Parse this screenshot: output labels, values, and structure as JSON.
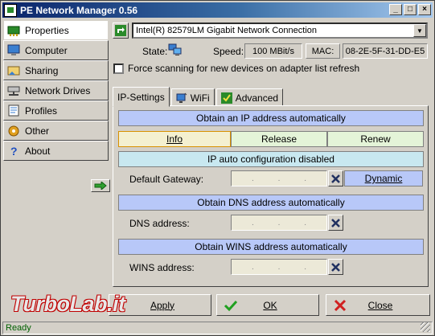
{
  "window": {
    "title": "PE Network Manager 0.56",
    "controls": {
      "minimize": "_",
      "maximize": "□",
      "close": "×"
    }
  },
  "sidebar": {
    "items": [
      {
        "label": "Properties",
        "icon": "network-card-icon",
        "active": true
      },
      {
        "label": "Computer",
        "icon": "computer-icon",
        "active": false
      },
      {
        "label": "Sharing",
        "icon": "sharing-icon",
        "active": false
      },
      {
        "label": "Network Drives",
        "icon": "network-drive-icon",
        "active": false
      },
      {
        "label": "Profiles",
        "icon": "profiles-icon",
        "active": false
      },
      {
        "label": "Other",
        "icon": "other-icon",
        "active": false
      },
      {
        "label": "About",
        "icon": "help-icon",
        "active": false
      }
    ]
  },
  "adapter": {
    "selected": "Intel(R) 82579LM Gigabit Network Connection"
  },
  "status": {
    "state_label": "State:",
    "speed_label": "Speed:",
    "speed_value": "100 MBit/s",
    "mac_label": "MAC:",
    "mac_value": "08-2E-5F-31-DD-E5"
  },
  "force_scan": {
    "label": "Force scanning for new devices on adapter list refresh",
    "checked": false
  },
  "tabs": [
    {
      "label": "IP-Settings",
      "active": true
    },
    {
      "label": "WiFi",
      "active": false
    },
    {
      "label": "Advanced",
      "active": false
    }
  ],
  "ip_settings": {
    "obtain_ip": "Obtain an IP address automatically",
    "info": "Info",
    "release": "Release",
    "renew": "Renew",
    "autoconfig": "IP auto configuration disabled",
    "gateway_label": "Default Gateway:",
    "dynamic": "Dynamic",
    "obtain_dns": "Obtain DNS address automatically",
    "dns_label": "DNS address:",
    "obtain_wins": "Obtain WINS address automatically",
    "wins_label": "WINS address:",
    "ip_dots": [
      ".",
      " .",
      "."
    ]
  },
  "buttons": {
    "apply": "Apply",
    "ok": "OK",
    "close": "Close"
  },
  "watermark": "TurboLab.it",
  "statusbar": "Ready",
  "colors": {
    "title_gradient_start": "#0a246a",
    "bar_blue": "#b8c8f8",
    "bar_cyan": "#c8e8f0",
    "seg_green": "#e4f4d8",
    "status_text": "#006000"
  }
}
